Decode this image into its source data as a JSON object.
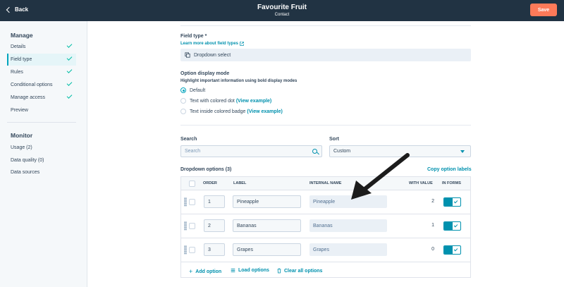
{
  "header": {
    "back_label": "Back",
    "title": "Favourite Fruit",
    "subtitle": "Contact",
    "save_label": "Save"
  },
  "sidebar": {
    "manage_title": "Manage",
    "manage_items": [
      {
        "label": "Details",
        "checked": true
      },
      {
        "label": "Field type",
        "checked": true,
        "active": true
      },
      {
        "label": "Rules",
        "checked": true
      },
      {
        "label": "Conditional options",
        "checked": true
      },
      {
        "label": "Manage access",
        "checked": true
      },
      {
        "label": "Preview",
        "checked": false
      }
    ],
    "monitor_title": "Monitor",
    "monitor_items": [
      {
        "label": "Usage (2)"
      },
      {
        "label": "Data quality (0)"
      },
      {
        "label": "Data sources"
      }
    ]
  },
  "field_type": {
    "label": "Field type *",
    "learn_link": "Learn more about field types",
    "value": "Dropdown select"
  },
  "display_mode": {
    "label": "Option display mode",
    "help": "Highlight important information using bold display modes",
    "options": [
      {
        "label": "Default",
        "selected": true,
        "link": ""
      },
      {
        "label": "Text with colored dot",
        "selected": false,
        "link": "(View example)"
      },
      {
        "label": "Text inside colored badge",
        "selected": false,
        "link": "(View example)"
      }
    ]
  },
  "search": {
    "label": "Search",
    "placeholder": "Search"
  },
  "sort": {
    "label": "Sort",
    "value": "Custom"
  },
  "dropdown_options": {
    "title": "Dropdown options (3)",
    "copy_link": "Copy option labels",
    "columns": [
      "ORDER",
      "LABEL",
      "INTERNAL NAME",
      "WITH VALUE",
      "IN FORMS"
    ],
    "rows": [
      {
        "order": "1",
        "label": "Pineapple",
        "internal": "Pineapple",
        "with_value": "2",
        "in_forms": true
      },
      {
        "order": "2",
        "label": "Bananas",
        "internal": "Bananas",
        "with_value": "1",
        "in_forms": true
      },
      {
        "order": "3",
        "label": "Grapes",
        "internal": "Grapes",
        "with_value": "0",
        "in_forms": true
      }
    ]
  },
  "actions": {
    "add": "Add option",
    "load": "Load options",
    "clear": "Clear all options"
  },
  "colors": {
    "header_bg": "#213343",
    "save_bg": "#ff7a59",
    "accent": "#0091ae",
    "check": "#00bda5"
  },
  "icons": [
    "back-chevron-icon",
    "external-link-icon",
    "dropdown-select-icon",
    "search-icon",
    "caret-down-icon",
    "drag-handle-icon",
    "plus-icon",
    "list-icon",
    "trash-icon",
    "annotation-arrow"
  ]
}
